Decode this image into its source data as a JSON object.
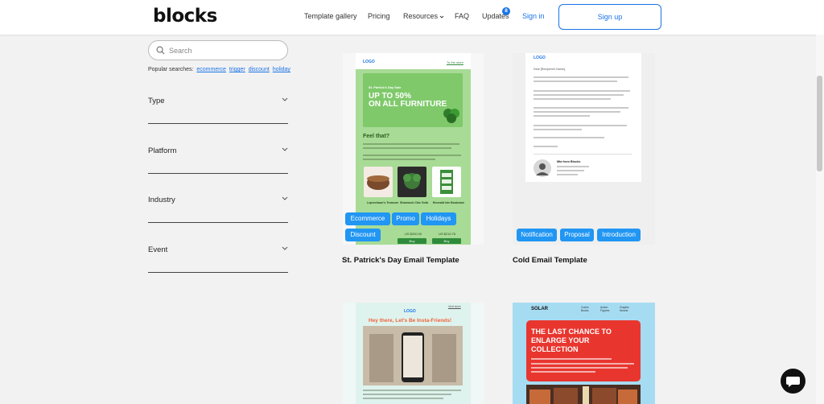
{
  "header": {
    "logo": "blocks",
    "nav": [
      "Template gallery",
      "Pricing",
      "Resources",
      "FAQ",
      "Updates"
    ],
    "updates_badge": "8",
    "sign_in": "Sign in",
    "sign_up": "Sign up"
  },
  "sidebar": {
    "search_placeholder": "Search",
    "popular_label": "Popular searches:",
    "popular_tags": [
      "ecommerce",
      "trigger",
      "discount",
      "holiday"
    ],
    "filters": [
      "Type",
      "Platform",
      "Industry",
      "Event"
    ]
  },
  "cards": [
    {
      "title": "St. Patrick's Day Email Template",
      "tags": [
        "Ecommerce",
        "Promo",
        "Holidays",
        "Discount"
      ],
      "preview": {
        "logo": "LOGO",
        "link": "To the store",
        "hero_small": "St. Patrick's Day Sale",
        "hero_line1": "UP TO 50%",
        "hero_line2": "ON ALL FURNITURE",
        "heading": "Feel that?",
        "products": [
          "Leprechaun's Treasure",
          "Shamrock Chic Sofa",
          "Emerald Isle Bookcase"
        ],
        "prices": [
          "US $200.00",
          "US $210.76"
        ],
        "buy": "Buy"
      },
      "accent": "#a8db96"
    },
    {
      "title": "Cold Email Template",
      "tags": [
        "Notification",
        "Proposal",
        "Introduction"
      ],
      "preview": {
        "logo": "LOGO",
        "greeting": "Dear [Recipient's Name],",
        "sign_name": "Mia from Blocks"
      }
    },
    {
      "preview": {
        "logo": "LOGO",
        "link": "Visit store",
        "headline": "Hey there, Let's Be Insta-Friends!"
      }
    },
    {
      "preview": {
        "logo": "SOLAR",
        "nav": [
          "Comic Books",
          "Action Figures",
          "Graphic Novels"
        ],
        "headline": [
          "THE LAST CHANCE TO",
          "ENLARGE YOUR",
          "COLLECTION"
        ]
      },
      "accent": "#e8362f"
    }
  ],
  "colors": {
    "brand_blue": "#1a73e8",
    "chip_blue": "#2196f3"
  }
}
